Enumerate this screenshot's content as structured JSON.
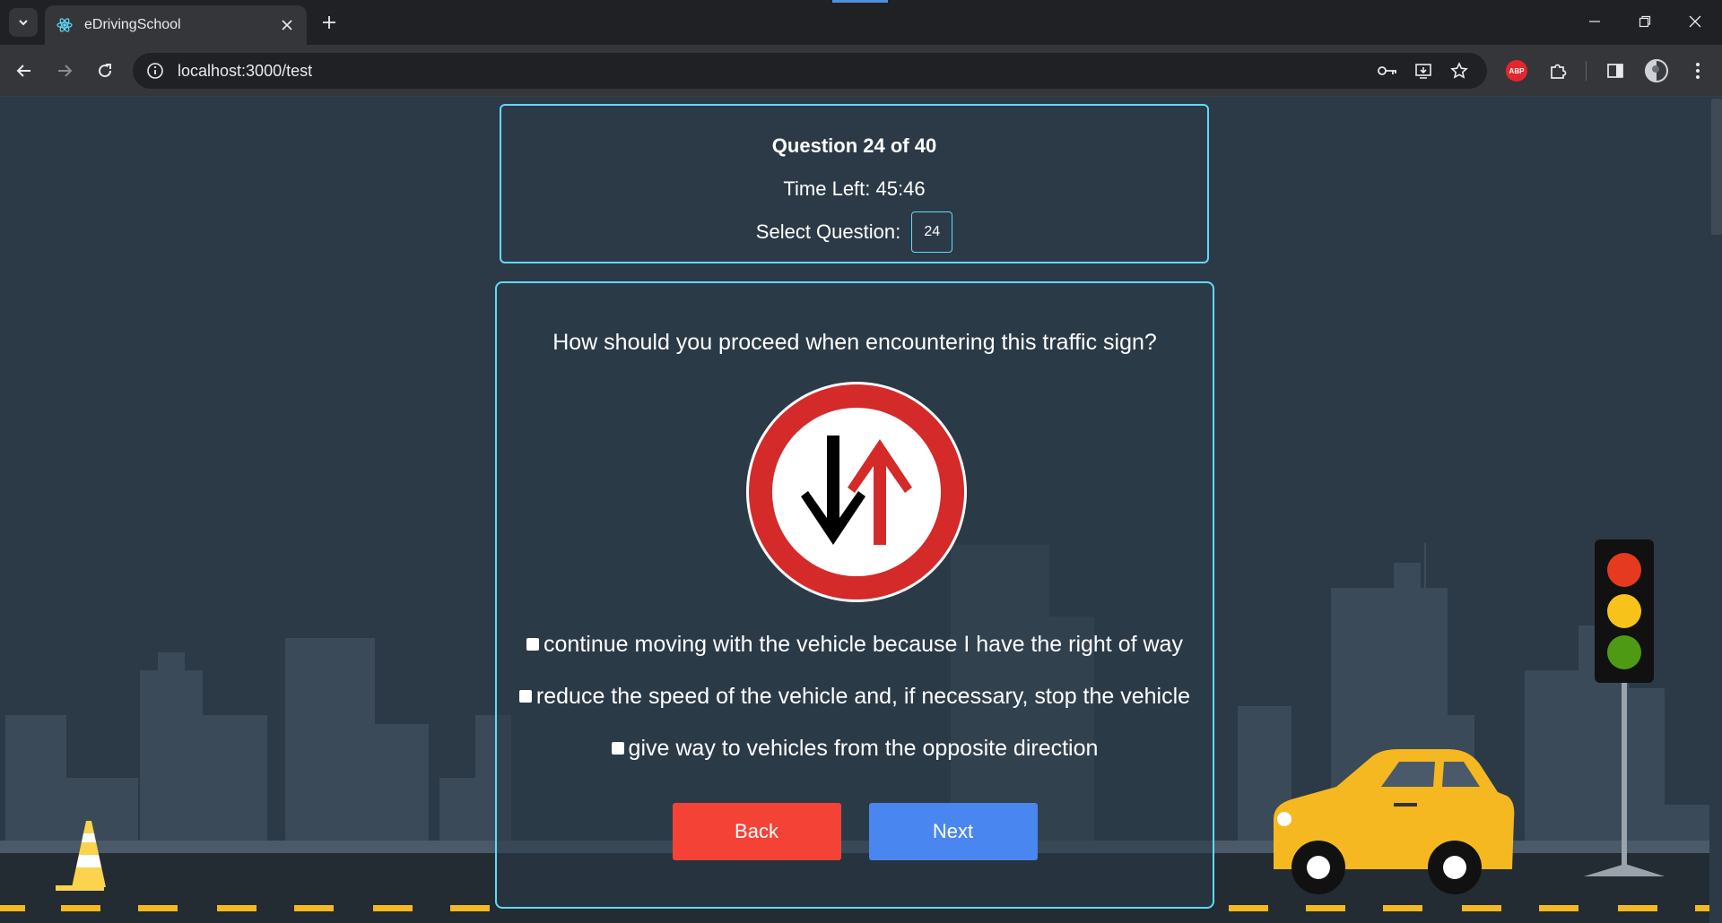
{
  "browser": {
    "tab_title": "eDrivingSchool",
    "url": "localhost:3000/test"
  },
  "test": {
    "question_counter": "Question 24 of 40",
    "time_left": "Time Left: 45:46",
    "select_label": "Select Question:",
    "selected_question": "24",
    "question_text": "How should you proceed when encountering this traffic sign?",
    "sign_icon": "priority-to-oncoming-traffic-sign",
    "answers": [
      {
        "text": "continue moving with the vehicle because I have the right of way",
        "checked": false
      },
      {
        "text": "reduce the speed of the vehicle and, if necessary, stop the vehicle",
        "checked": false
      },
      {
        "text": "give way to vehicles from the opposite direction",
        "checked": false
      }
    ],
    "back_label": "Back",
    "next_label": "Next"
  },
  "colors": {
    "accent": "#61dafb",
    "back": "#f44336",
    "next": "#4a86f0",
    "background": "#2c3a47"
  }
}
